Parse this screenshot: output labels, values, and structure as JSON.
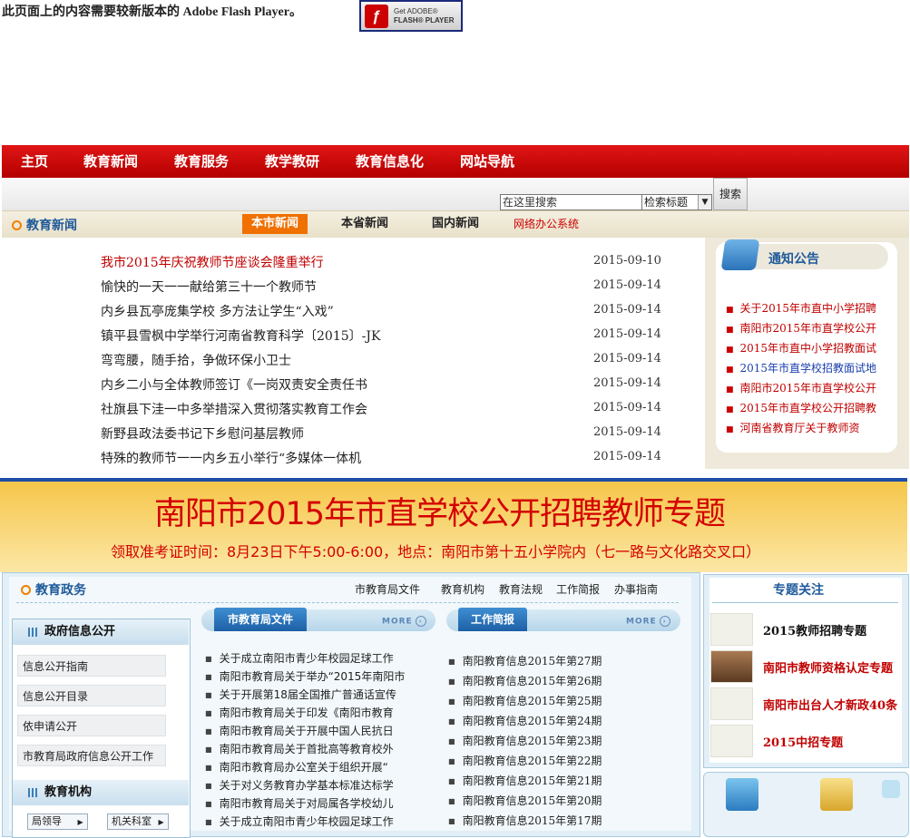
{
  "flash": {
    "message": "此页面上的内容需要较新版本的 Adobe Flash Player。",
    "button_top": "Get ADOBE®",
    "button_bottom": "FLASH® PLAYER"
  },
  "nav": [
    "主页",
    "教育新闻",
    "教育服务",
    "教学教研",
    "教育信息化",
    "网站导航"
  ],
  "search": {
    "input_value": "在这里搜索",
    "select_value": "检索标题",
    "button_label": "搜索"
  },
  "news": {
    "title": "教育新闻",
    "tabs": [
      "本市新闻",
      "本省新闻",
      "国内新闻"
    ],
    "office_link": "网络办公系统",
    "items": [
      {
        "title": "我市2015年庆祝教师节座谈会隆重举行",
        "date": "2015-09-10",
        "highlight": true
      },
      {
        "title": "愉快的一天一一献给第三十一个教师节",
        "date": "2015-09-14"
      },
      {
        "title": "内乡县瓦亭庞集学校 多方法让学生“入戏”",
        "date": "2015-09-14"
      },
      {
        "title": "镇平县雪枫中学举行河南省教育科学〔2015〕-JK",
        "date": "2015-09-14"
      },
      {
        "title": "弯弯腰，随手拾，争做环保小卫士",
        "date": "2015-09-14"
      },
      {
        "title": "内乡二小与全体教师签订《一岗双责安全责任书",
        "date": "2015-09-14"
      },
      {
        "title": "社旗县下洼一中多举措深入贯彻落实教育工作会",
        "date": "2015-09-14"
      },
      {
        "title": "新野县政法委书记下乡慰问基层教师",
        "date": "2015-09-14"
      },
      {
        "title": "特殊的教师节一一内乡五小举行“多媒体一体机",
        "date": "2015-09-14"
      }
    ]
  },
  "notices": {
    "title": "通知公告",
    "items": [
      {
        "text": "关于2015年市直中小学招聘",
        "color": "#c00000"
      },
      {
        "text": "南阳市2015年市直学校公开",
        "color": "#c00000"
      },
      {
        "text": "2015年市直中小学招教面试",
        "color": "#c00000"
      },
      {
        "text": "2015年市直学校招教面试地",
        "color": "#1a3fb0"
      },
      {
        "text": "南阳市2015年市直学校公开",
        "color": "#c00000"
      },
      {
        "text": "2015年市直学校公开招聘教",
        "color": "#c00000"
      },
      {
        "text": "河南省教育厅关于教师资",
        "color": "#c00000"
      }
    ]
  },
  "banner": {
    "title": "南阳市2015年市直学校公开招聘教师专题",
    "subtitle": "领取准考证时间：8月23日下午5:00-6:00，地点：南阳市第十五小学院内（七一路与文化路交叉口）"
  },
  "gov": {
    "title": "教育政务",
    "links": [
      "市教育局文件",
      "教育机构",
      "教育法规",
      "工作简报",
      "办事指南"
    ],
    "info_open": {
      "title": "政府信息公开",
      "items": [
        "信息公开指南",
        "信息公开目录",
        "依申请公开",
        "市教育局政府信息公开工作"
      ]
    },
    "institutions": {
      "title": "教育机构",
      "buttons": [
        "局领导",
        "机关科室"
      ]
    },
    "more_label": "MORE",
    "docs": {
      "title": "市教育局文件",
      "items": [
        "关于成立南阳市青少年校园足球工作",
        "南阳市教育局关于举办“2015年南阳市",
        "关于开展第18届全国推广普通话宣传",
        "南阳市教育局关于印发《南阳市教育",
        "南阳市教育局关于开展中国人民抗日",
        "南阳市教育局关于首批高等教育校外",
        "南阳市教育局办公室关于组织开展“",
        "关于对义务教育办学基本标准达标学",
        "南阳市教育局关于对局属各学校幼儿",
        "关于成立南阳市青少年校园足球工作"
      ]
    },
    "briefs": {
      "title": "工作简报",
      "items": [
        "南阳教育信息2015年第27期",
        "南阳教育信息2015年第26期",
        "南阳教育信息2015年第25期",
        "南阳教育信息2015年第24期",
        "南阳教育信息2015年第23期",
        "南阳教育信息2015年第22期",
        "南阳教育信息2015年第21期",
        "南阳教育信息2015年第20期",
        "南阳教育信息2015年第17期"
      ]
    }
  },
  "topics": {
    "title": "专题关注",
    "items": [
      {
        "text": "2015教师招聘专题",
        "color": "#111111"
      },
      {
        "text": "南阳市教师资格认定专题",
        "color": "#c00000"
      },
      {
        "text": "南阳市出台人才新政40条",
        "color": "#c00000"
      },
      {
        "text": "2015中招专题",
        "color": "#c00000"
      }
    ]
  }
}
